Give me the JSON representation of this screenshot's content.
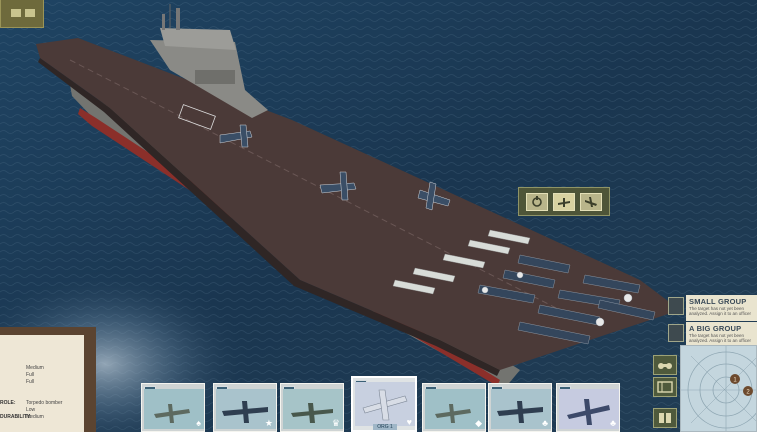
{
  "hud": {
    "groups": [
      {
        "title": "SMALL GROUP",
        "desc": "The target has not yet been analyzed. Assign it to an officer"
      },
      {
        "title": "A BIG GROUP",
        "desc": "The target has not yet been analyzed. Assign it to an officer"
      }
    ],
    "action_icons": [
      "repair-icon",
      "launch-plane-icon",
      "land-plane-icon"
    ],
    "radar_contacts": [
      "1",
      "2"
    ]
  },
  "clipboard": {
    "values": [
      "Medium",
      "Full",
      "Full"
    ],
    "role_label": "ROLE:",
    "role_value": "Torpedo bomber",
    "extra_value": "Low",
    "durability_label": "DURABILITY:",
    "durability_value": "Medium"
  },
  "squadrons": [
    {
      "name": "card-1",
      "mark": "♠",
      "selected": false
    },
    {
      "name": "card-2",
      "mark": "★",
      "selected": false
    },
    {
      "name": "card-3",
      "mark": "♛",
      "selected": false
    },
    {
      "name": "card-4",
      "mark": "♥",
      "selected": true,
      "label": "ORG 1"
    },
    {
      "name": "card-5",
      "mark": "◆",
      "selected": false
    },
    {
      "name": "card-6",
      "mark": "♣",
      "selected": false
    },
    {
      "name": "card-7",
      "mark": "♣",
      "selected": false
    }
  ],
  "colors": {
    "ocean": "#1d3a52",
    "deck": "#4b3a38",
    "hud_olive": "#4e5538",
    "paper": "#e9e4cf"
  }
}
